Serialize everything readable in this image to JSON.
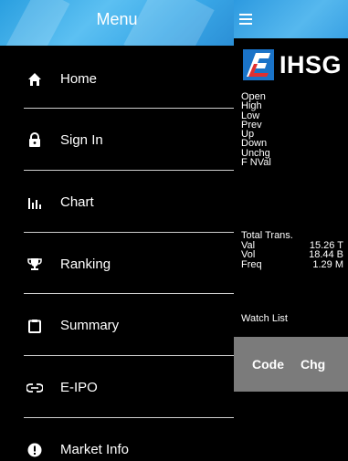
{
  "drawer": {
    "title": "Menu",
    "items": [
      {
        "label": "Home",
        "icon": "home-icon"
      },
      {
        "label": "Sign In",
        "icon": "lock-icon"
      },
      {
        "label": "Chart",
        "icon": "bar-chart-icon"
      },
      {
        "label": "Ranking",
        "icon": "trophy-icon"
      },
      {
        "label": "Summary",
        "icon": "clipboard-icon"
      },
      {
        "label": "E-IPO",
        "icon": "link-icon"
      },
      {
        "label": "Market Info",
        "icon": "info-icon"
      }
    ]
  },
  "panel": {
    "brand": "IHSG",
    "stats_labels": [
      "Open",
      "High",
      "Low",
      "Prev",
      "Up",
      "Down",
      "Unchg",
      "F NVal"
    ],
    "totals": {
      "title": "Total Trans.",
      "rows": [
        {
          "label": "Val",
          "value": "15.26 T"
        },
        {
          "label": "Vol",
          "value": "18.44 B"
        },
        {
          "label": "Freq",
          "value": "1.29 M"
        }
      ]
    },
    "watchlist": {
      "title": "Watch List",
      "columns": [
        "Code",
        "Chg"
      ]
    }
  },
  "colors": {
    "header_blue": "#3aa9e8",
    "background": "#000000",
    "watch_header": "#7b7b7b"
  }
}
